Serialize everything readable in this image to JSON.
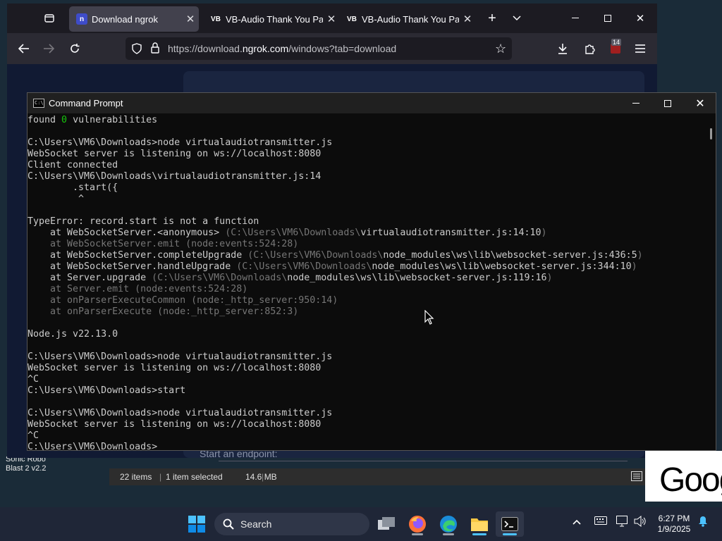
{
  "desktop": {
    "icon_label": "Sonic Robo\nBlast 2 v2.2"
  },
  "browser": {
    "tabs": [
      {
        "title": "Download ngrok",
        "favicon": "n",
        "active": true
      },
      {
        "title": "VB-Audio Thank You Page",
        "favicon": "VB",
        "active": false
      },
      {
        "title": "VB-Audio Thank You Page",
        "favicon": "VB",
        "active": false
      }
    ],
    "url_prefix": "https://download.",
    "url_domain": "ngrok.com",
    "url_suffix": "/windows?tab=download",
    "extension_badge": "14",
    "endpoint_hint": "Start an endpoint:"
  },
  "explorer_status": {
    "items": "22 items",
    "selected": "1 item selected",
    "size": "14.6 MB"
  },
  "google_tile": {
    "text": "Goog"
  },
  "cmd": {
    "title": "Command Prompt",
    "lines": [
      [
        {
          "t": "found "
        },
        {
          "t": "0",
          "c": "g"
        },
        {
          "t": " vulnerabilities"
        }
      ],
      [],
      [
        {
          "t": "C:\\Users\\VM6\\Downloads>node virtualaudiotransmitter.js"
        }
      ],
      [
        {
          "t": "WebSocket server is listening on ws://localhost:8080"
        }
      ],
      [
        {
          "t": "Client connected"
        }
      ],
      [
        {
          "t": "C:\\Users\\VM6\\Downloads\\virtualaudiotransmitter.js:14"
        }
      ],
      [
        {
          "t": "        .start({"
        }
      ],
      [
        {
          "t": "         ^"
        }
      ],
      [],
      [
        {
          "t": "TypeError: record.start is not a function"
        }
      ],
      [
        {
          "t": "    at WebSocketServer.<anonymous> "
        },
        {
          "t": "(C:\\Users\\VM6\\Downloads\\",
          "c": "d"
        },
        {
          "t": "virtualaudiotransmitter.js:14:10"
        },
        {
          "t": ")",
          "c": "d"
        }
      ],
      [
        {
          "t": "    at WebSocketServer.emit (node:events:524:28)",
          "c": "d"
        }
      ],
      [
        {
          "t": "    at WebSocketServer.completeUpgrade "
        },
        {
          "t": "(C:\\Users\\VM6\\Downloads\\",
          "c": "d"
        },
        {
          "t": "node_modules\\ws\\lib\\websocket-server.js:436:5"
        },
        {
          "t": ")",
          "c": "d"
        }
      ],
      [
        {
          "t": "    at WebSocketServer.handleUpgrade "
        },
        {
          "t": "(C:\\Users\\VM6\\Downloads\\",
          "c": "d"
        },
        {
          "t": "node_modules\\ws\\lib\\websocket-server.js:344:10"
        },
        {
          "t": ")",
          "c": "d"
        }
      ],
      [
        {
          "t": "    at Server.upgrade "
        },
        {
          "t": "(C:\\Users\\VM6\\Downloads\\",
          "c": "d"
        },
        {
          "t": "node_modules\\ws\\lib\\websocket-server.js:119:16"
        },
        {
          "t": ")",
          "c": "d"
        }
      ],
      [
        {
          "t": "    at Server.emit (node:events:524:28)",
          "c": "d"
        }
      ],
      [
        {
          "t": "    at onParserExecuteCommon (node:_http_server:950:14)",
          "c": "d"
        }
      ],
      [
        {
          "t": "    at onParserExecute (node:_http_server:852:3)",
          "c": "d"
        }
      ],
      [],
      [
        {
          "t": "Node.js v22.13.0"
        }
      ],
      [],
      [
        {
          "t": "C:\\Users\\VM6\\Downloads>node virtualaudiotransmitter.js"
        }
      ],
      [
        {
          "t": "WebSocket server is listening on ws://localhost:8080"
        }
      ],
      [
        {
          "t": "^C"
        }
      ],
      [
        {
          "t": "C:\\Users\\VM6\\Downloads>start"
        }
      ],
      [],
      [
        {
          "t": "C:\\Users\\VM6\\Downloads>node virtualaudiotransmitter.js"
        }
      ],
      [
        {
          "t": "WebSocket server is listening on ws://localhost:8080"
        }
      ],
      [
        {
          "t": "^C"
        }
      ],
      [
        {
          "t": "C:\\Users\\VM6\\Downloads>"
        }
      ]
    ]
  },
  "taskbar": {
    "search_label": "Search",
    "apps": [
      "start-icon",
      "task-view-icon",
      "firefox-icon",
      "edge-icon",
      "file-explorer-icon",
      "terminal-icon"
    ],
    "time": "6:27 PM",
    "date": "1/9/2025"
  },
  "colors": {
    "accent": "#0078d4",
    "cmd_bg": "#0c0c0c",
    "cmd_text": "#cccccc",
    "cmd_green": "#16c60c",
    "cmd_dim": "#767676"
  }
}
